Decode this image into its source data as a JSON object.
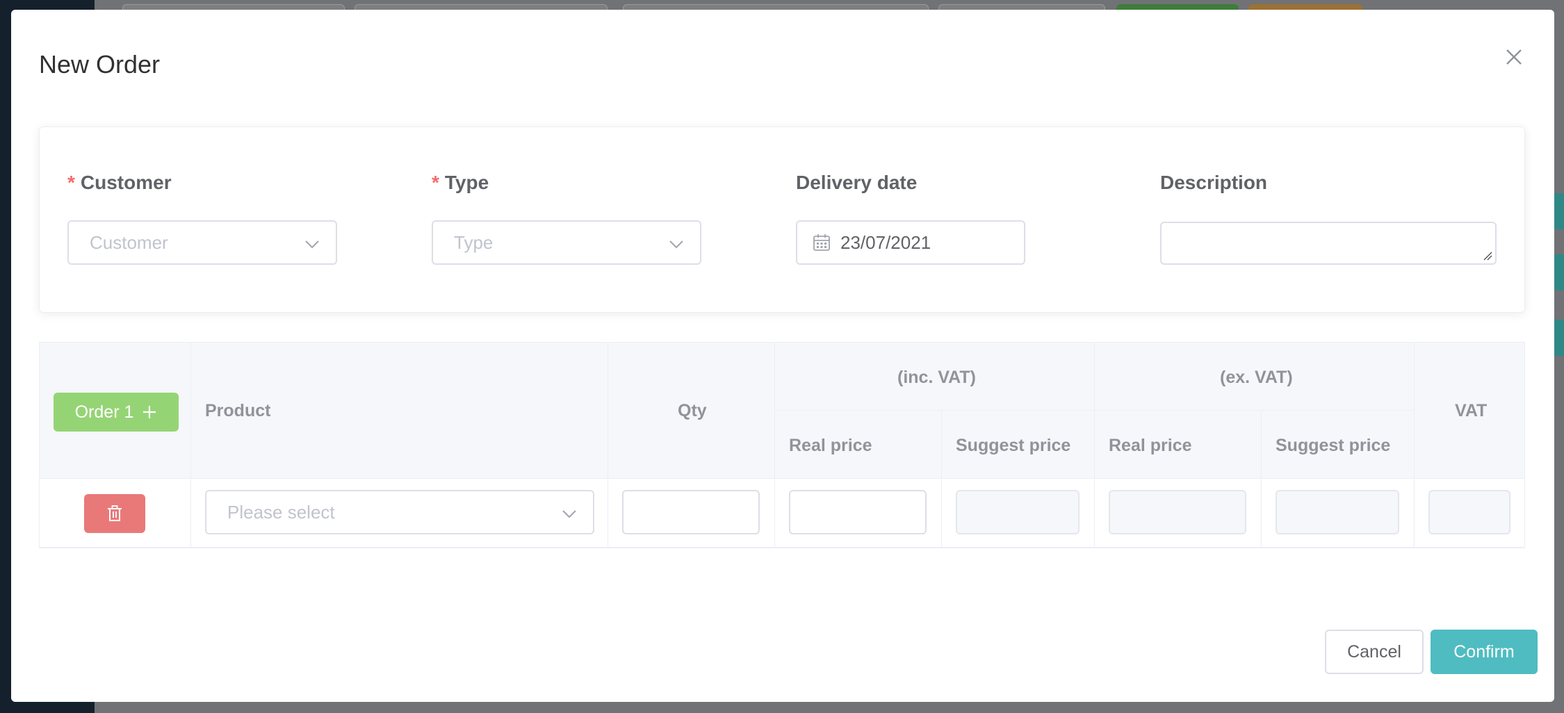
{
  "modal": {
    "title": "New Order"
  },
  "form": {
    "customer": {
      "label": "Customer",
      "required_mark": "*",
      "placeholder": "Customer"
    },
    "type": {
      "label": "Type",
      "required_mark": "*",
      "placeholder": "Type"
    },
    "delivery_date": {
      "label": "Delivery date",
      "value": "23/07/2021"
    },
    "description": {
      "label": "Description",
      "value": ""
    }
  },
  "table": {
    "add_button_label": "Order 1",
    "headers": {
      "product": "Product",
      "qty": "Qty",
      "inc_vat": "(inc. VAT)",
      "ex_vat": "(ex. VAT)",
      "real_price": "Real price",
      "suggest_price": "Suggest price",
      "vat": "VAT"
    },
    "row": {
      "product_placeholder": "Please select"
    }
  },
  "footer": {
    "cancel_label": "Cancel",
    "confirm_label": "Confirm"
  },
  "colors": {
    "green_button": "#95d475",
    "red_button": "#e97979",
    "confirm_button": "#4fbcc1",
    "required": "#f56c6c"
  }
}
